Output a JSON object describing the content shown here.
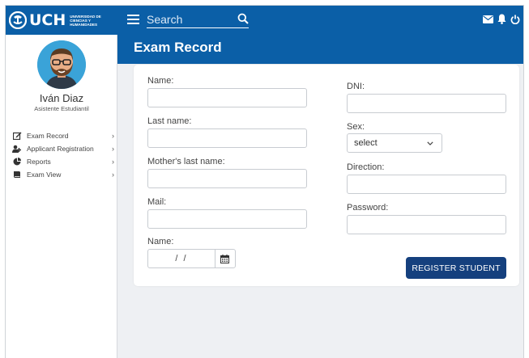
{
  "brand": {
    "name": "UCH",
    "subtitle_line1": "UNIVERSIDAD DE",
    "subtitle_line2": "CIENCIAS Y",
    "subtitle_line3": "HUMANIDADES"
  },
  "search": {
    "placeholder": "Search"
  },
  "user": {
    "name": "Iván Diaz",
    "role": "Asistente Estudiantil"
  },
  "nav": [
    {
      "label": "Exam Record",
      "icon": "edit-icon"
    },
    {
      "label": "Applicant Registration",
      "icon": "users-icon"
    },
    {
      "label": "Reports",
      "icon": "pie-chart-icon"
    },
    {
      "label": "Exam View",
      "icon": "book-icon"
    }
  ],
  "page": {
    "title": "Exam Record"
  },
  "form": {
    "name_label": "Name:",
    "last_name_label": "Last name:",
    "mothers_last_name_label": "Mother's last name:",
    "mail_label": "Mail:",
    "date_label": "Name:",
    "date_value": "/   /",
    "dni_label": "DNI:",
    "sex_label": "Sex:",
    "sex_selected": "select",
    "direction_label": "Direction:",
    "password_label": "Password:",
    "submit_label": "REGISTER STUDENT"
  },
  "colors": {
    "primary": "#0b5fa7",
    "button": "#15407e",
    "background": "#eef0f3"
  }
}
